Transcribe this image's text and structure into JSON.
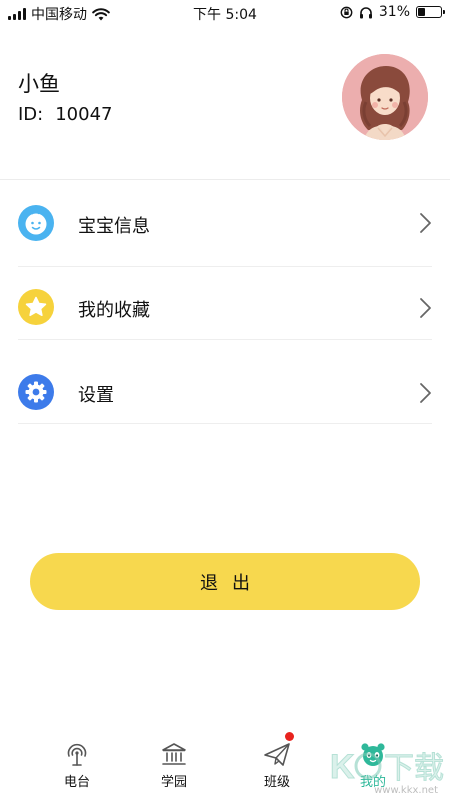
{
  "status_bar": {
    "carrier": "中国移动",
    "time": "下午 5:04",
    "battery": "31%",
    "battery_level": 0.31
  },
  "profile": {
    "name": "小鱼",
    "id_label": "ID:",
    "id_value": "10047"
  },
  "menu": {
    "items": [
      {
        "label": "宝宝信息",
        "icon": "baby-face-icon",
        "color": "#4ab3f0"
      },
      {
        "label": "我的收藏",
        "icon": "star-icon",
        "color": "#f6d23c"
      },
      {
        "label": "设置",
        "icon": "gear-icon",
        "color": "#3d7bea"
      }
    ]
  },
  "logout": {
    "label": "退出"
  },
  "tabbar": {
    "tabs": [
      {
        "label": "电台",
        "icon": "radio-icon"
      },
      {
        "label": "学园",
        "icon": "school-icon"
      },
      {
        "label": "班级",
        "icon": "paper-plane-icon",
        "badge": true
      },
      {
        "label": "我的",
        "icon": "panda-face-icon",
        "active": true
      }
    ],
    "active_color": "#2fb89a"
  },
  "watermark": {
    "text": "www.kkx.net"
  }
}
